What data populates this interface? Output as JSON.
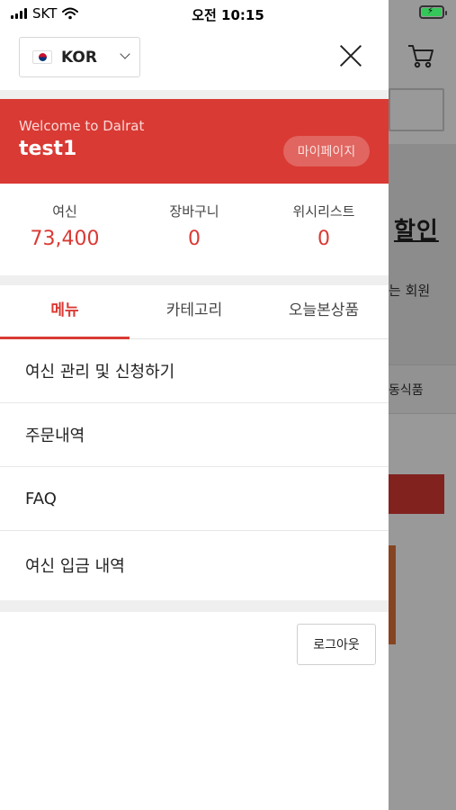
{
  "status_bar": {
    "carrier": "SKT",
    "time": "오전 10:15"
  },
  "drawer": {
    "language": {
      "selected": "KOR"
    },
    "profile": {
      "welcome": "Welcome to Dalrat",
      "username": "test1",
      "mypage_label": "마이페이지"
    },
    "stats": [
      {
        "label": "여신",
        "value": "73,400"
      },
      {
        "label": "장바구니",
        "value": "0"
      },
      {
        "label": "위시리스트",
        "value": "0"
      }
    ],
    "tabs": [
      {
        "label": "메뉴",
        "active": true
      },
      {
        "label": "카테고리",
        "active": false
      },
      {
        "label": "오늘본상품",
        "active": false
      }
    ],
    "menu_items": [
      {
        "label": "여신 관리 및 신청하기"
      },
      {
        "label": "주문내역"
      },
      {
        "label": "FAQ"
      },
      {
        "label": "여신 입금 내역"
      }
    ],
    "logout_label": "로그아웃"
  },
  "background": {
    "sale_text": "할인",
    "member_text": "는 회원",
    "category_text": "동식품"
  },
  "colors": {
    "accent": "#d93a34",
    "battery": "#35c759"
  },
  "icons": {
    "close": "close-icon",
    "cart": "cart-icon",
    "chevron": "chevron-down-icon",
    "flag": "korea-flag-icon"
  }
}
